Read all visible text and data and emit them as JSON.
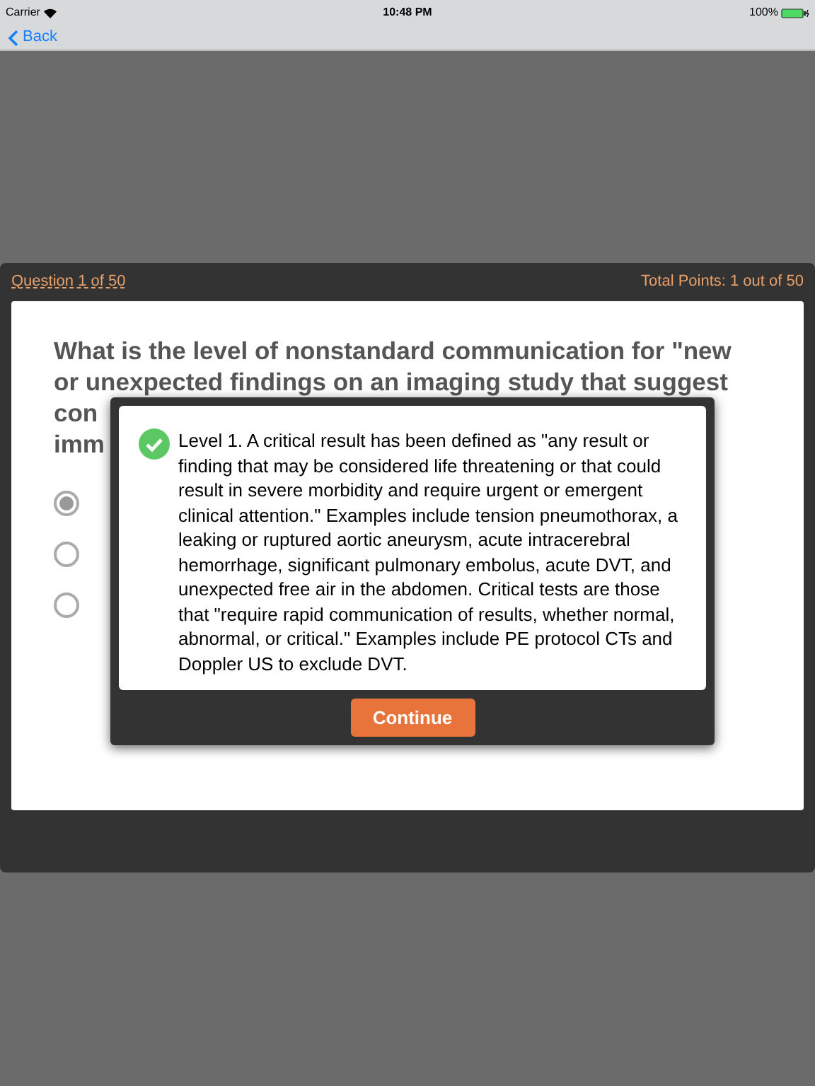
{
  "status_bar": {
    "carrier": "Carrier",
    "time": "10:48 PM",
    "battery": "100%"
  },
  "nav": {
    "back": "Back"
  },
  "quiz": {
    "progress": "Question 1 of 50",
    "points": "Total Points: 1 out of 50",
    "question_lines": [
      "What is the level of nonstandard communication for \"new",
      "or unexpected findings on an imaging study that suggest",
      "con",
      "imm"
    ],
    "options": [
      {
        "selected": true
      },
      {
        "selected": false
      },
      {
        "selected": false
      }
    ]
  },
  "feedback": {
    "correct": true,
    "text": "Level 1. A critical result has been defined as \"any result or finding that may be considered life threatening or that could result in severe morbidity and require urgent or emergent clinical attention.\" Examples include tension pneumothorax, a leaking or ruptured aortic aneurysm, acute intracerebral hemorrhage, significant pulmonary embolus, acute DVT, and unexpected free air in the abdomen. Critical tests are those that \"require rapid communication of results, whether normal, abnormal, or critical.\" Examples include PE protocol CTs and Doppler US to exclude DVT.",
    "button": "Continue"
  }
}
